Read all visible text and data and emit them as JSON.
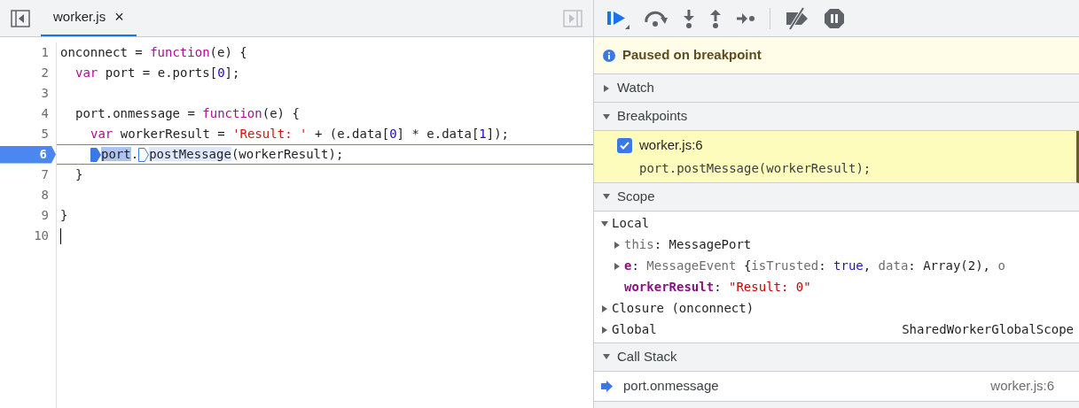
{
  "editor": {
    "tabs": [
      {
        "label": "worker.js",
        "close": "×",
        "selected": true
      }
    ],
    "lines": [
      {
        "number": "1",
        "current": false,
        "tokens": [
          {
            "kind": "plain",
            "text": "onconnect = "
          },
          {
            "kind": "keyword",
            "text": "function"
          },
          {
            "kind": "plain",
            "text": "(e) {"
          }
        ],
        "children": [
          {
            "number": "2",
            "current": false,
            "tokens": [
              {
                "kind": "keyword",
                "text": "var"
              },
              {
                "kind": "plain",
                "text": " port = e.ports["
              },
              {
                "kind": "number",
                "text": "0"
              },
              {
                "kind": "plain",
                "text": "];"
              }
            ]
          },
          {
            "number": "3",
            "current": false
          },
          {
            "number": "4",
            "current": false,
            "tokens": [
              {
                "kind": "plain",
                "text": "port.onmessage = "
              },
              {
                "kind": "keyword",
                "text": "function"
              },
              {
                "kind": "plain",
                "text": "(e) {"
              }
            ],
            "children": [
              {
                "number": "5",
                "current": false,
                "tokens": [
                  {
                    "kind": "keyword",
                    "text": "var"
                  },
                  {
                    "kind": "plain",
                    "text": " workerResult = "
                  },
                  {
                    "kind": "string",
                    "text": "'Result: '"
                  },
                  {
                    "kind": "plain",
                    "text": " + (e.data["
                  },
                  {
                    "kind": "number",
                    "text": "0"
                  },
                  {
                    "kind": "plain",
                    "text": "] * e.data["
                  },
                  {
                    "kind": "number",
                    "text": "1"
                  },
                  {
                    "kind": "plain",
                    "text": "]);"
                  }
                ]
              },
              {
                "number": "6",
                "current": true,
                "tokens": [
                  {
                    "kind": "marker",
                    "active": true
                  },
                  {
                    "kind": "selected",
                    "text": "port"
                  },
                  {
                    "kind": "plain",
                    "text": "."
                  },
                  {
                    "kind": "marker",
                    "active": false
                  },
                  {
                    "kind": "hover",
                    "text": "postMessage"
                  },
                  {
                    "kind": "plain",
                    "text": "(workerResult);"
                  }
                ]
              }
            ]
          },
          {
            "number": "7",
            "current": false,
            "tokens": [
              {
                "kind": "plain",
                "text": "}"
              }
            ]
          },
          {
            "number": "8",
            "current": false
          }
        ]
      },
      {
        "number": "9",
        "current": false,
        "tokens": [
          {
            "kind": "plain",
            "text": "}"
          }
        ]
      },
      {
        "number": "10",
        "current": false,
        "cursor": true
      }
    ]
  },
  "debugger": {
    "status": "Paused on breakpoint",
    "sections": [
      {
        "kind": "watch",
        "title": "Watch",
        "expanded": false
      },
      {
        "kind": "breakpoints",
        "title": "Breakpoints",
        "expanded": true,
        "items": [
          {
            "checked": true,
            "location": "worker.js:6",
            "code": "port.postMessage(workerResult);"
          }
        ]
      },
      {
        "kind": "scope",
        "title": "Scope",
        "expanded": true,
        "tree": [
          {
            "label": "Local",
            "expanded": true,
            "children": [
              {
                "name": "this",
                "own": false,
                "expanded": false,
                "value": [
                  {
                    "kind": "plain",
                    "text": ": MessagePort"
                  }
                ]
              },
              {
                "name": "e",
                "own": true,
                "expanded": false,
                "value": [
                  {
                    "kind": "plain",
                    "text": ": "
                  },
                  {
                    "kind": "dim",
                    "text": "MessageEvent "
                  },
                  {
                    "kind": "plain",
                    "text": "{"
                  },
                  {
                    "kind": "dim",
                    "text": "isTrusted"
                  },
                  {
                    "kind": "plain",
                    "text": ": "
                  },
                  {
                    "kind": "keyword",
                    "text": "true"
                  },
                  {
                    "kind": "plain",
                    "text": ", "
                  },
                  {
                    "kind": "dim",
                    "text": "data"
                  },
                  {
                    "kind": "plain",
                    "text": ": Array(2), "
                  },
                  {
                    "kind": "dim",
                    "text": "o"
                  }
                ]
              },
              {
                "name": "workerResult",
                "own": true,
                "value": [
                  {
                    "kind": "plain",
                    "text": ": "
                  },
                  {
                    "kind": "string",
                    "text": "\"Result: 0\""
                  }
                ]
              }
            ]
          },
          {
            "label": "Closure (onconnect)",
            "expanded": false
          },
          {
            "label": "Global",
            "expanded": false,
            "right": "SharedWorkerGlobalScope"
          }
        ]
      },
      {
        "kind": "callstack",
        "title": "Call Stack",
        "expanded": true,
        "frames": [
          {
            "name": "port.onmessage",
            "location": "worker.js:6",
            "current": true
          }
        ]
      }
    ]
  }
}
